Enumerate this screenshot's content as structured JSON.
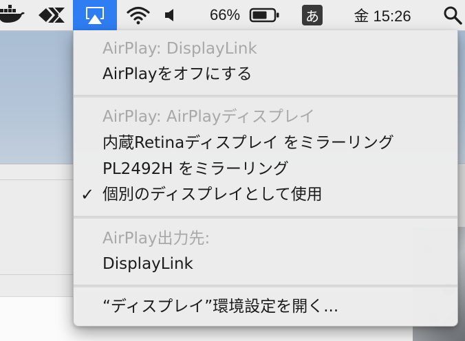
{
  "menubar": {
    "battery_percent": "66%",
    "input_method": "あ",
    "day_time": "金 15:26"
  },
  "airplay_menu": {
    "section1": {
      "header": "AirPlay: DisplayLink",
      "items": [
        "AirPlayをオフにする"
      ]
    },
    "section2": {
      "header": "AirPlay: AirPlayディスプレイ",
      "items": [
        "内蔵Retinaディスプレイ をミラーリング",
        "PL2492H をミラーリング",
        "個別のディスプレイとして使用"
      ],
      "checked_item": "個別のディスプレイとして使用"
    },
    "section3": {
      "header": "AirPlay出力先:",
      "items": [
        "DisplayLink"
      ]
    },
    "footer": {
      "open_prefs": "“ディスプレイ”環境設定を開く..."
    }
  },
  "check_glyph": "✓",
  "colors": {
    "menu_bg": "#ececec",
    "header_text": "#a8a8a8",
    "item_text": "#1b1b1b",
    "airplay_highlight": "#2f7df2"
  }
}
